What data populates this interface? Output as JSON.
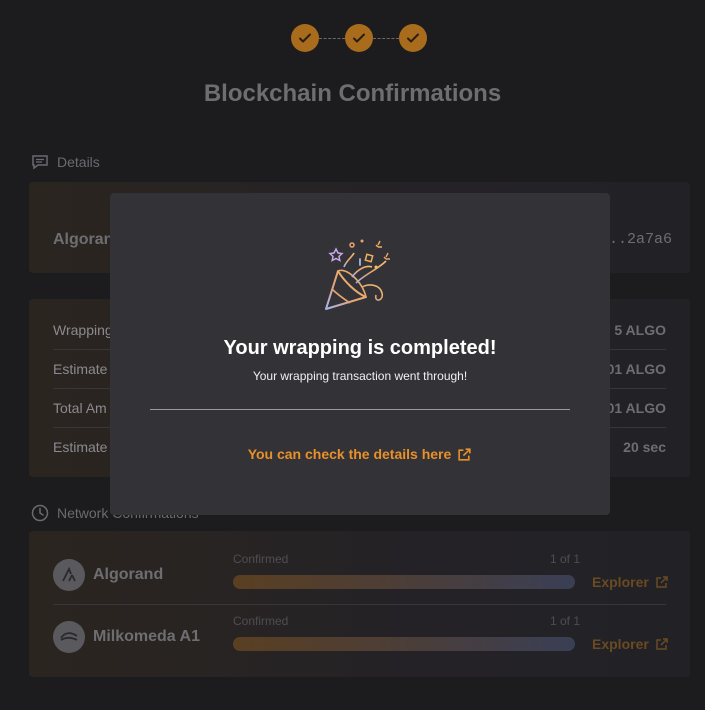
{
  "page": {
    "title": "Blockchain Confirmations",
    "steps_completed": 3
  },
  "details": {
    "section_label": "Details",
    "network_name": "Algoran",
    "hash_tail": "..2a7a6"
  },
  "summary": {
    "rows": [
      {
        "label": "Wrapping",
        "value": "5 ALGO"
      },
      {
        "label": "Estimate",
        "value": "101 ALGO"
      },
      {
        "label": "Total Am",
        "value": "101 ALGO"
      },
      {
        "label": "Estimate",
        "value": "20 sec"
      }
    ]
  },
  "network_confirmations": {
    "section_label": "Network Confirmations",
    "networks": [
      {
        "name": "Algorand",
        "status": "Confirmed",
        "count": "1 of 1",
        "progress": 1.0,
        "explorer_label": "Explorer",
        "icon": "algorand-icon"
      },
      {
        "name": "Milkomeda A1",
        "status": "Confirmed",
        "count": "1 of 1",
        "progress": 1.0,
        "explorer_label": "Explorer",
        "icon": "milkomeda-icon"
      }
    ]
  },
  "modal": {
    "title": "Your wrapping is completed!",
    "subtitle": "Your wrapping transaction went through!",
    "link_label": "You can check the details here",
    "icon": "party-popper-icon"
  },
  "colors": {
    "accent": "#e8902a",
    "step_fill": "#a86c1c",
    "modal_bg": "#333237"
  }
}
